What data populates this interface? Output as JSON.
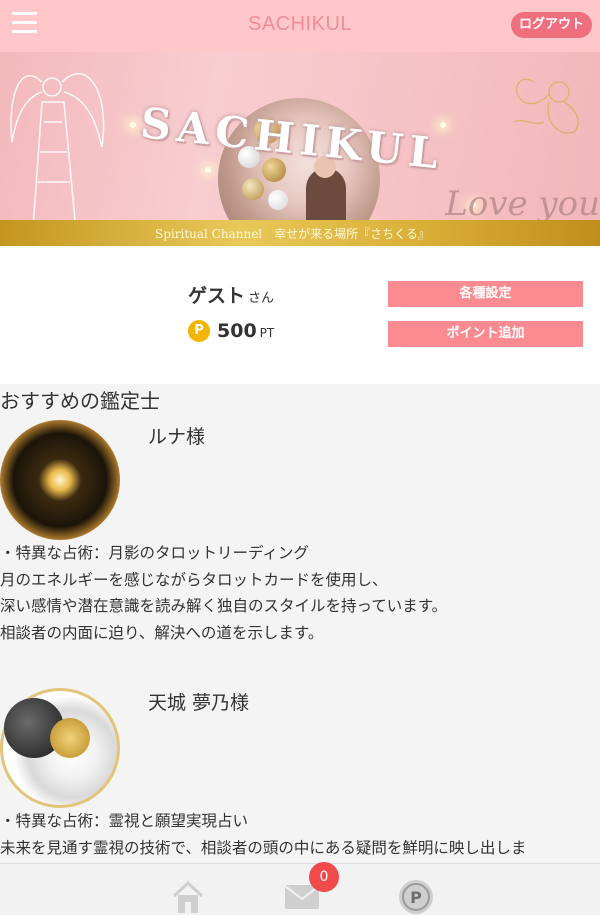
{
  "header": {
    "title": "SACHIKUL",
    "logout_label": "ログアウト"
  },
  "banner": {
    "brand": "SACHIKUL",
    "love_text": "Love you",
    "strip_text": "Spiritual Channel　幸せが来る場所『さちくる』"
  },
  "user": {
    "name": "ゲスト",
    "honorific": "さん",
    "point_icon_label": "P",
    "points": "500",
    "point_unit": "PT",
    "settings_label": "各種設定",
    "add_points_label": "ポイント追加"
  },
  "recommended": {
    "title": "おすすめの鑑定士",
    "fortune_tellers": [
      {
        "name": "ルナ様",
        "description": [
          "・特異な占術：月影のタロットリーディング",
          "月のエネルギーを感じながらタロットカードを使用し、",
          "深い感情や潜在意識を読み解く独自のスタイルを持っています。",
          "相談者の内面に迫り、解決への道を示します。"
        ]
      },
      {
        "name": "天城 夢乃様",
        "description": [
          "・特異な占術：霊視と願望実現占い",
          "未来を見通す霊視の技術で、相談者の頭の中にある疑問を鮮明に映し出しま"
        ]
      }
    ]
  },
  "footer": {
    "icons": [
      "home-icon",
      "mail-icon",
      "point-icon"
    ],
    "mail_badge": "0"
  },
  "colors": {
    "header_bg": "#ffc7c9",
    "title_pink": "#f08d96",
    "button_pink": "#fb8b91",
    "logout_pink": "#f06f7e",
    "badge_red": "#f04a4a",
    "gold": "#f4b400"
  }
}
